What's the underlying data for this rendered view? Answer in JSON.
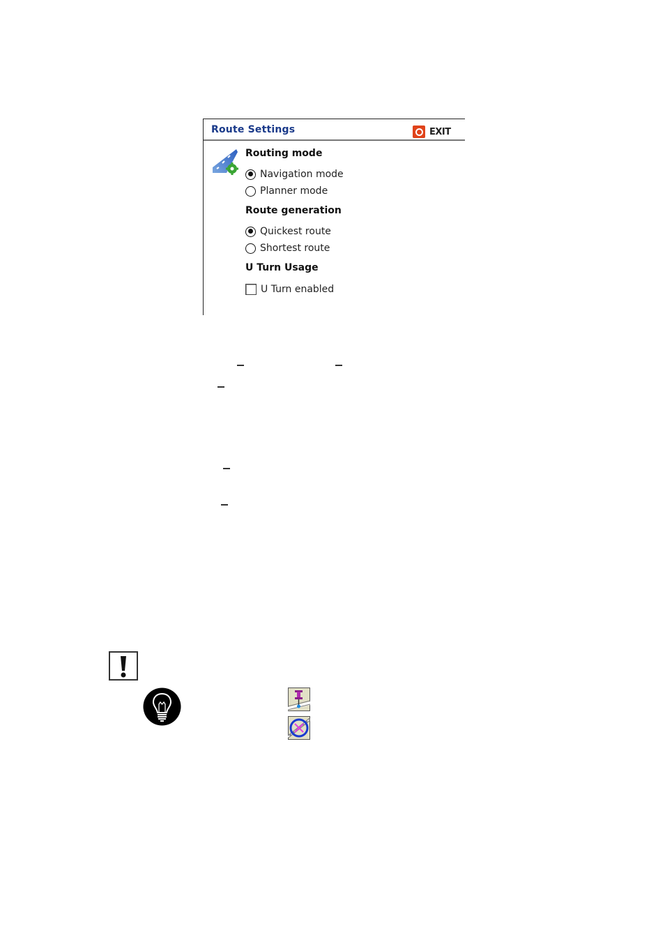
{
  "window": {
    "title": "Route Settings",
    "exit_label": "EXIT",
    "accent_color": "#1a3a8a",
    "exit_color": "#e0431a"
  },
  "sections": [
    {
      "title": "Routing mode",
      "type": "radio",
      "options": [
        {
          "label": "Navigation mode",
          "checked": true
        },
        {
          "label": "Planner mode",
          "checked": false
        }
      ]
    },
    {
      "title": "Route generation",
      "type": "radio",
      "options": [
        {
          "label": "Quickest route",
          "checked": true
        },
        {
          "label": "Shortest route",
          "checked": false
        }
      ]
    },
    {
      "title": "U Turn Usage",
      "type": "checkbox",
      "options": [
        {
          "label": "U Turn enabled",
          "checked": false
        }
      ]
    }
  ],
  "icons": {
    "route_settings": "road-gear-icon",
    "warning": "exclamation-icon",
    "tip": "lightbulb-icon",
    "pin": "map-pin-icon",
    "compass": "compass-icon"
  }
}
